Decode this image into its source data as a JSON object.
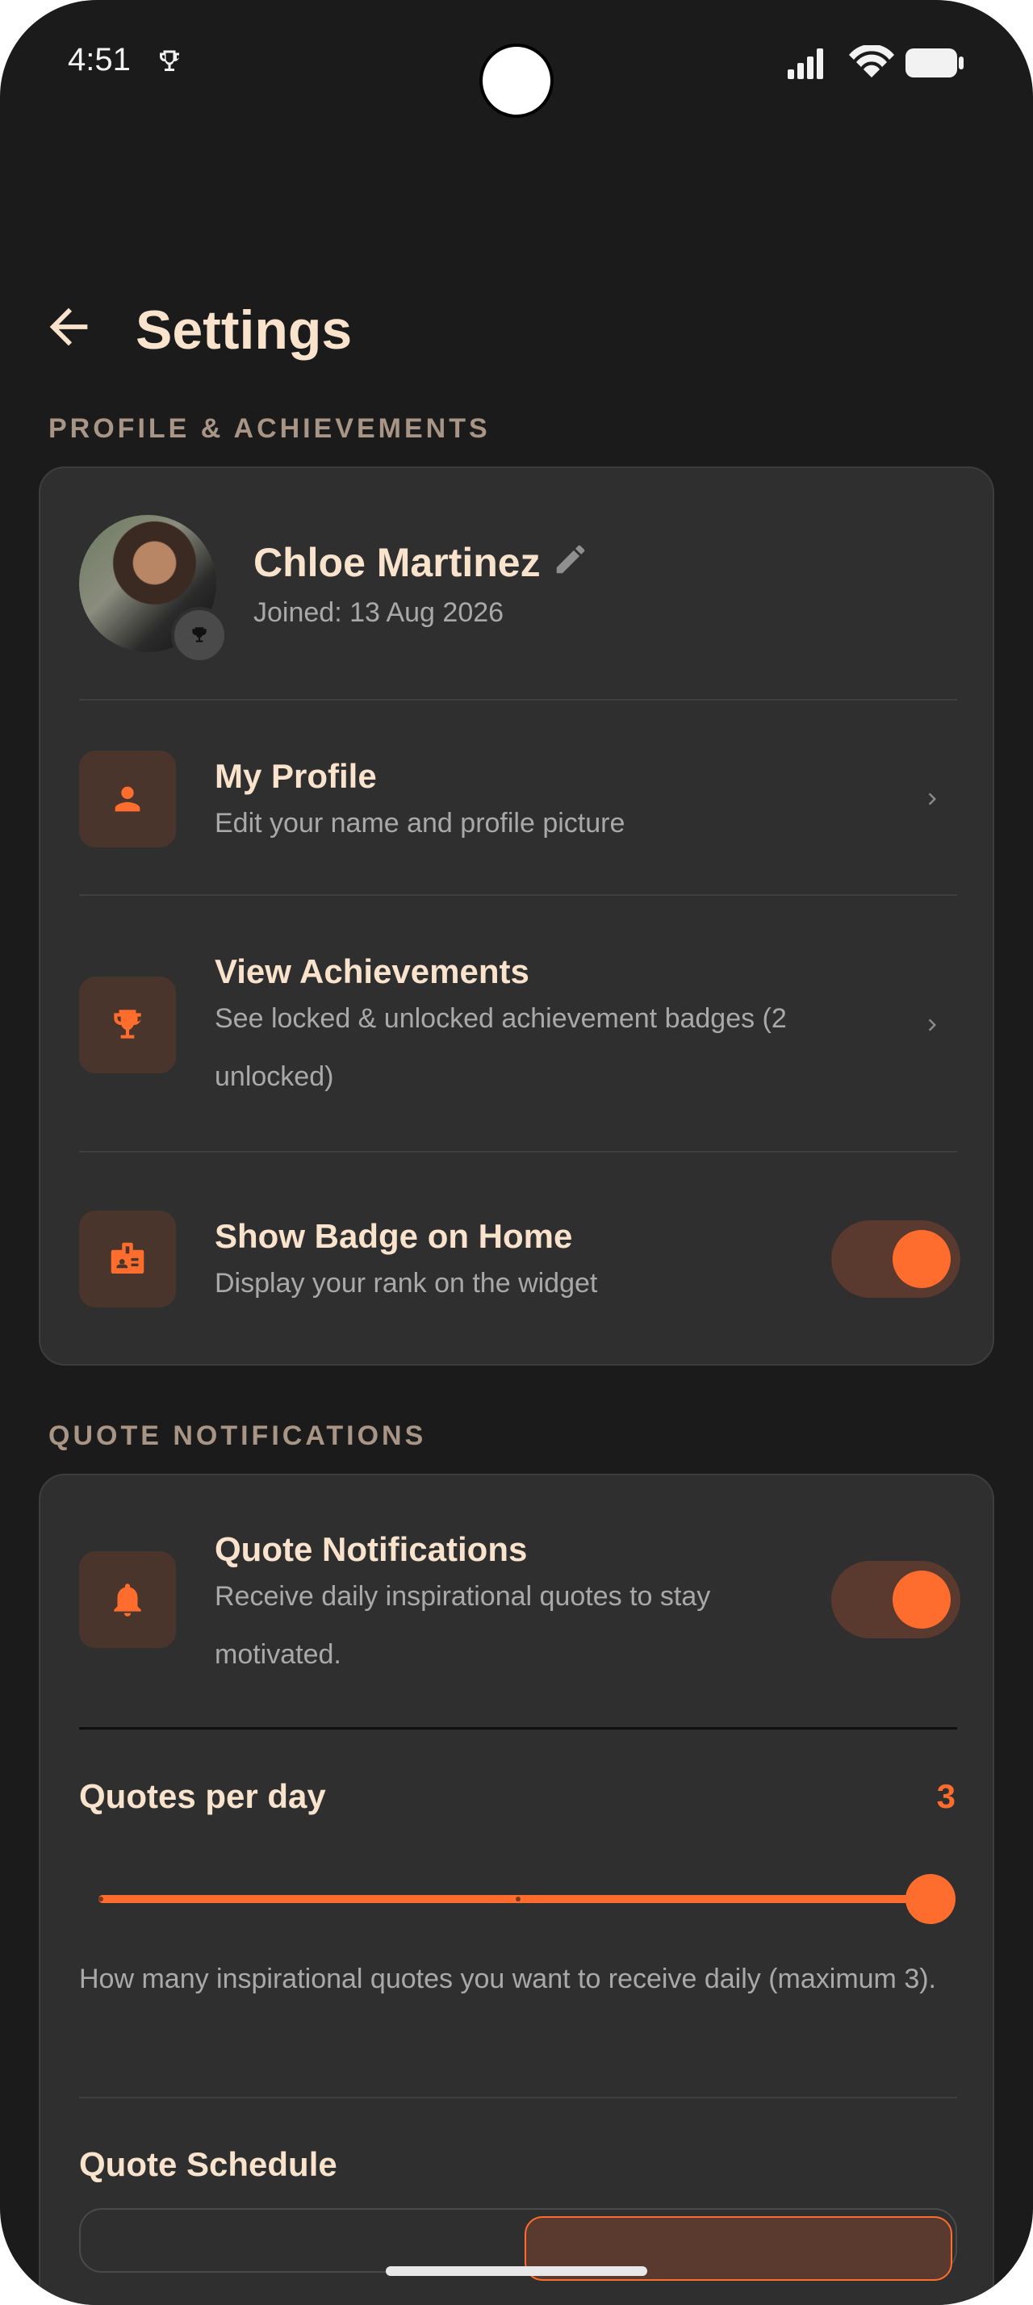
{
  "status_bar": {
    "time": "4:51",
    "icons": [
      "trophy-icon",
      "signal-icon",
      "wifi-icon",
      "battery-icon"
    ]
  },
  "header": {
    "title": "Settings",
    "back_icon": "arrow-left-icon"
  },
  "sections": {
    "profile_label": "PROFILE & ACHIEVEMENTS",
    "notifications_label": "QUOTE NOTIFICATIONS"
  },
  "profile": {
    "name": "Chloe Martinez",
    "joined": "Joined: 13 Aug 2026"
  },
  "rows": {
    "my_profile": {
      "title": "My Profile",
      "subtitle": "Edit your name and profile picture",
      "icon": "person-icon"
    },
    "achievements": {
      "title": "View Achievements",
      "subtitle": "See locked & unlocked achievement badges (2 unlocked)",
      "icon": "trophy-icon"
    },
    "badge": {
      "title": "Show Badge on Home",
      "subtitle": "Display your rank on the widget",
      "icon": "badge-icon",
      "enabled": true
    },
    "quote_notifications": {
      "title": "Quote Notifications",
      "subtitle": "Receive daily inspirational quotes to stay motivated.",
      "icon": "bell-icon",
      "enabled": true
    }
  },
  "quotes_per_day": {
    "label": "Quotes per day",
    "value": "3",
    "min": 1,
    "max": 3,
    "current": 3,
    "help": "How many inspirational quotes you want to receive daily (maximum 3)."
  },
  "schedule": {
    "title": "Quote Schedule"
  },
  "colors": {
    "accent": "#ff6d2e",
    "background": "#1b1b1b",
    "card": "#2f2f2f",
    "title_text": "#f9e3cc"
  }
}
